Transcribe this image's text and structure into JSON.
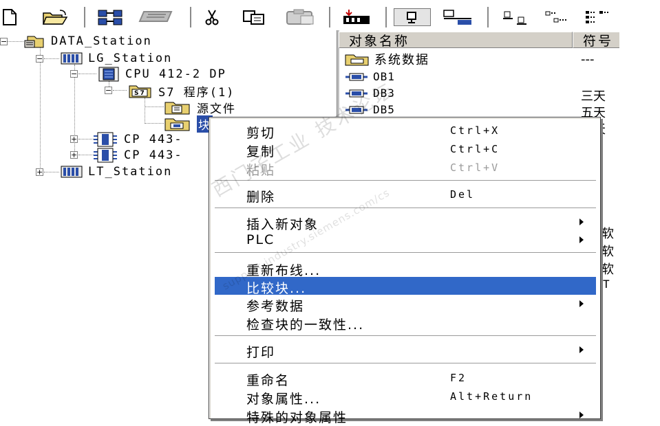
{
  "toolbar": {
    "buttons": [
      "new-icon",
      "open-icon",
      "network-icon",
      "memory-card-icon",
      "cut-icon",
      "copy-icon",
      "paste-icon",
      "download-icon",
      "online-icon",
      "accessible-nodes-icon",
      "large-icons-icon",
      "small-icons-icon",
      "list-view-icon"
    ]
  },
  "tree": {
    "root": "DATA_Station",
    "lg_station": "LG_Station",
    "cpu": "CPU 412-2 DP",
    "s7_badge": "S7",
    "s7_program": "S7 程序(1)",
    "sources": "源文件",
    "blocks_partial": "块",
    "cp1": "CP 443-",
    "cp2": "CP 443-",
    "lt_station": "LT_Station"
  },
  "list": {
    "headers": [
      "对象名称",
      "符号"
    ],
    "rows": [
      {
        "name": "系统数据",
        "symbol": "---"
      },
      {
        "name": "OB1",
        "symbol": ""
      },
      {
        "name": "DB3",
        "symbol": "三天"
      },
      {
        "name": "DB5",
        "symbol": "五天"
      },
      {
        "name": "",
        "symbol": "五天"
      }
    ],
    "partial_right": [
      "软",
      "软",
      "软",
      "T"
    ]
  },
  "context_menu": {
    "items": [
      {
        "label": "剪切",
        "shortcut": "Ctrl+X",
        "disabled": false,
        "submenu": false
      },
      {
        "label": "复制",
        "shortcut": "Ctrl+C",
        "disabled": false,
        "submenu": false
      },
      {
        "label": "粘贴",
        "shortcut": "Ctrl+V",
        "disabled": true,
        "submenu": false
      },
      {
        "label": "删除",
        "shortcut": "Del",
        "disabled": false,
        "submenu": false
      },
      {
        "label": "插入新对象",
        "shortcut": "",
        "disabled": false,
        "submenu": true
      },
      {
        "label": "PLC",
        "shortcut": "",
        "disabled": false,
        "submenu": true
      },
      {
        "label": "重新布线...",
        "shortcut": "",
        "disabled": false,
        "submenu": false
      },
      {
        "label": "比较块...",
        "shortcut": "",
        "disabled": false,
        "submenu": false,
        "highlighted": true
      },
      {
        "label": "参考数据",
        "shortcut": "",
        "disabled": false,
        "submenu": true
      },
      {
        "label": "检查块的一致性...",
        "shortcut": "",
        "disabled": false,
        "submenu": false
      },
      {
        "label": "打印",
        "shortcut": "",
        "disabled": false,
        "submenu": true
      },
      {
        "label": "重命名",
        "shortcut": "F2",
        "disabled": false,
        "submenu": false
      },
      {
        "label": "对象属性...",
        "shortcut": "Alt+Return",
        "disabled": false,
        "submenu": false
      },
      {
        "label": "特殊的对象属性",
        "shortcut": "",
        "disabled": false,
        "submenu": true
      }
    ]
  },
  "watermark": {
    "text": "西门子工业 技术论坛",
    "url": "support.industry.siemens.com/cs"
  },
  "colors": {
    "highlight": "#3168c8",
    "disabled_text": "#9a9a9a",
    "folder": "#e8d070",
    "block": "#2a4ea8"
  }
}
